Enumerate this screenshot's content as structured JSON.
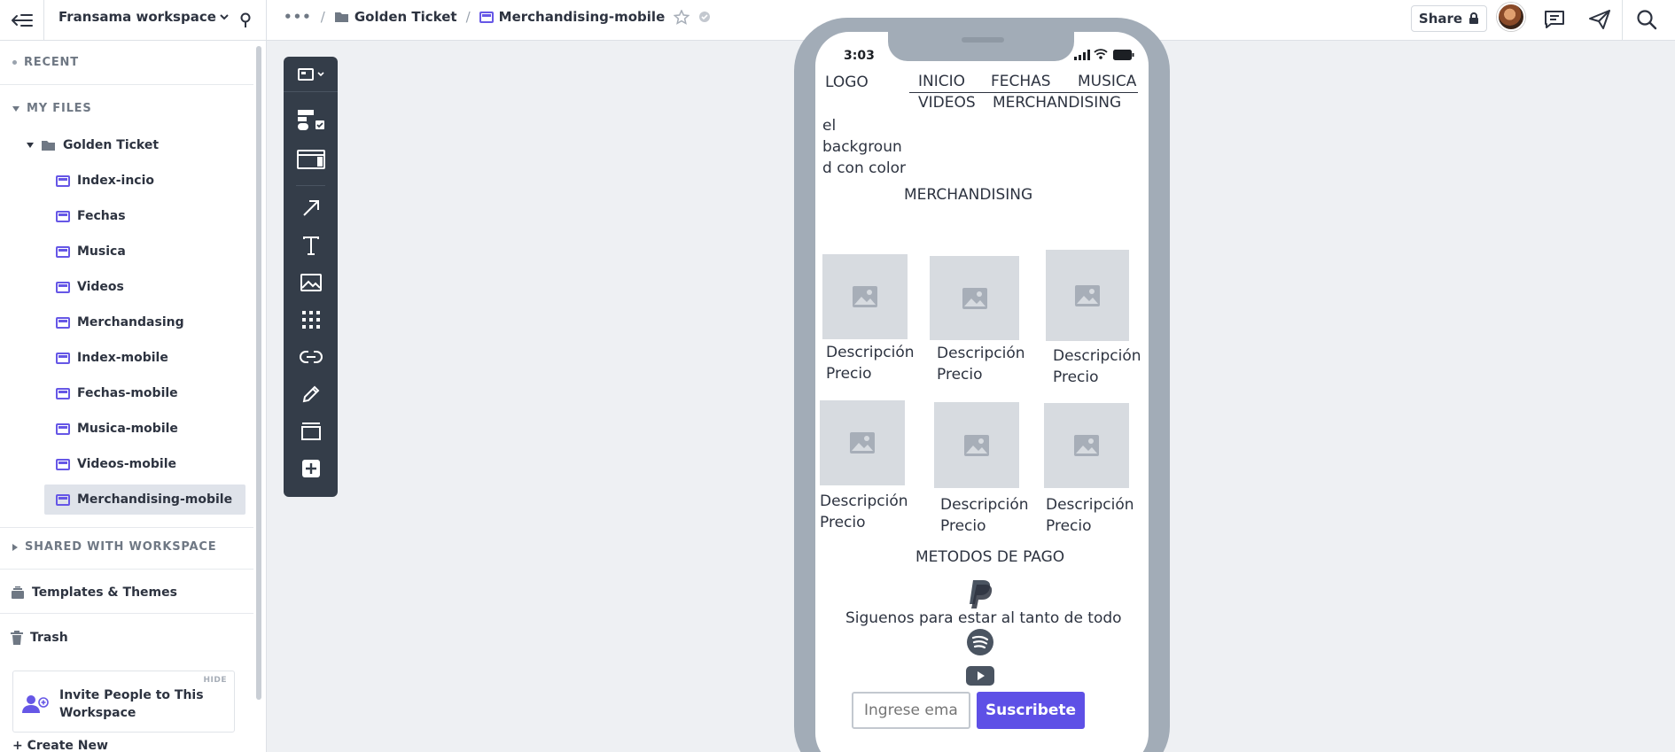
{
  "topbar": {
    "workspace_name": "Fransama workspace",
    "breadcrumb": [
      {
        "label": "Golden Ticket",
        "icon": "folder-icon"
      },
      {
        "label": "Merchandising-mobile",
        "icon": "page-icon"
      }
    ],
    "share_label": "Share"
  },
  "sidebar": {
    "recent_label": "RECENT",
    "my_files_label": "MY FILES",
    "folder_label": "Golden Ticket",
    "items": [
      {
        "label": "Index-incio"
      },
      {
        "label": "Fechas"
      },
      {
        "label": "Musica"
      },
      {
        "label": "Videos"
      },
      {
        "label": "Merchandasing"
      },
      {
        "label": "Index-mobile"
      },
      {
        "label": "Fechas-mobile"
      },
      {
        "label": "Musica-mobile"
      },
      {
        "label": "Videos-mobile"
      },
      {
        "label": "Merchandising-mobile",
        "selected": true
      }
    ],
    "shared_label": "SHARED WITH WORKSPACE",
    "templates_label": "Templates & Themes",
    "trash_label": "Trash",
    "invite_label": "Invite People to This Workspace",
    "hide_label": "HIDE",
    "create_new_label": "+ Create New"
  },
  "canvas": {
    "status_time": "3:03",
    "logo": "LOGO",
    "nav": {
      "inicio": "INICIO",
      "fechas": "FECHAS",
      "musica": "MUSICA",
      "videos": "VIDEOS",
      "merchandising": "MERCHANDISING"
    },
    "bg_note_lines": [
      "el",
      "backgroun",
      "d con color"
    ],
    "section_title": "MERCHANDISING",
    "products": [
      {
        "desc": "Descripción",
        "price": "Precio"
      },
      {
        "desc": "Descripción",
        "price": "Precio"
      },
      {
        "desc": "Descripción",
        "price": "Precio"
      },
      {
        "desc": "Descripción",
        "price": "Precio"
      },
      {
        "desc": "Descripción",
        "price": "Precio"
      },
      {
        "desc": "Descripción",
        "price": "Precio"
      }
    ],
    "payment_title": "METODOS DE PAGO",
    "follow_text": "Siguenos para estar al tanto de todo",
    "email_placeholder": "Ingrese email",
    "subscribe_label": "Suscribete"
  },
  "colors": {
    "accent": "#5e50e6",
    "page_icon": "#6657e6",
    "palette_bg": "#343d49",
    "phone_frame": "#a2acb7",
    "image_placeholder": "#d7dbe0"
  }
}
